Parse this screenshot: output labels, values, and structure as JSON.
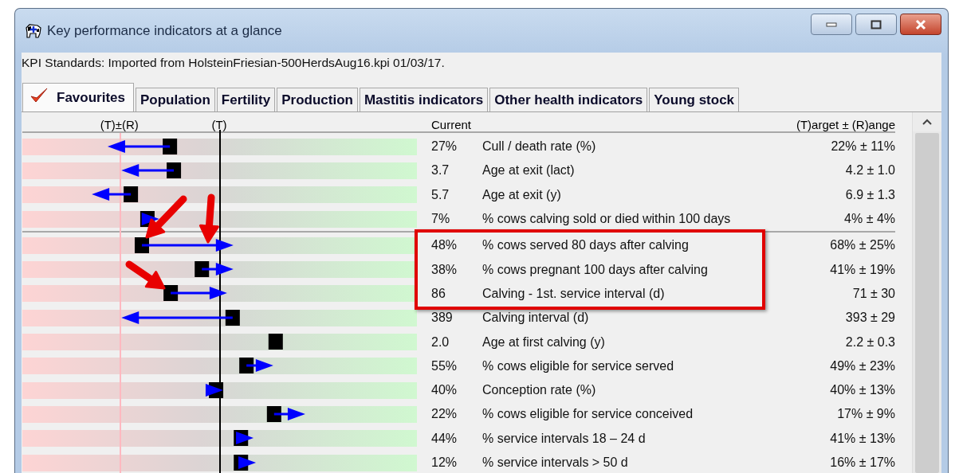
{
  "window": {
    "title": "Key performance indicators at a glance"
  },
  "standards": "KPI Standards: Imported from HolsteinFriesian-500HerdsAug16.kpi 01/03/17.",
  "tabs": [
    {
      "label": "Favourites",
      "selected": true
    },
    {
      "label": "Population",
      "selected": false
    },
    {
      "label": "Fertility",
      "selected": false
    },
    {
      "label": "Production",
      "selected": false
    },
    {
      "label": "Mastitis indicators",
      "selected": false
    },
    {
      "label": "Other health indicators",
      "selected": false
    },
    {
      "label": "Young stock",
      "selected": false
    }
  ],
  "header": {
    "range_label": "(T)±(R)",
    "target_label": "(T)",
    "current": "Current",
    "target_range": "(T)arget ± (R)ange"
  },
  "groups": [
    {
      "rows": [
        {
          "current_value": "27%",
          "name": "Cull / death rate (%)",
          "target": "22% ± 11%",
          "highlighted": false,
          "current": {
            "level": 0.374
          },
          "has_trend": true
        },
        {
          "current_value": "3.7",
          "name": "Age at exit (lact)",
          "target": "4.2 ± 1.0",
          "highlighted": false,
          "current": {
            "level": 0.384
          },
          "has_trend": true
        },
        {
          "current_value": "5.7",
          "name": "Age at exit (y)",
          "target": "6.9 ± 1.3",
          "highlighted": false,
          "current": {
            "level": 0.275
          },
          "has_trend": true
        },
        {
          "current_value": "7%",
          "name": "% cows calving sold or died within 100 days",
          "target": "4% ± 4%",
          "highlighted": false,
          "current": {
            "level": 0.317
          },
          "has_trend": true
        }
      ]
    },
    {
      "rows": [
        {
          "current_value": "48%",
          "name": "% cows served 80 days after calving",
          "target": "68% ± 25%",
          "highlighted": true,
          "current": {
            "level": 0.303
          },
          "has_trend": true,
          "pointers": [
            {
              "kind": "slash"
            },
            {
              "kind": "vertical"
            }
          ]
        },
        {
          "current_value": "38%",
          "name": "% cows pregnant 100 days after calving",
          "target": "41% ± 19%",
          "highlighted": true,
          "current": {
            "level": 0.455
          },
          "has_trend": true
        },
        {
          "current_value": "86",
          "name": "Calving - 1st. service interval (d)",
          "target": "71 ± 30",
          "highlighted": true,
          "current": {
            "level": 0.376
          },
          "has_trend": true,
          "pointers": [
            {
              "kind": "backslash"
            }
          ]
        },
        {
          "current_value": "389",
          "name": "Calving interval (d)",
          "target": "393 ± 29",
          "highlighted": false,
          "current": {
            "level": 0.533
          },
          "has_trend": true
        },
        {
          "current_value": "2.0",
          "name": "Age at first calving (y)",
          "target": "2.2 ± 0.3",
          "highlighted": false,
          "current": {
            "level": 0.642
          },
          "has_trend": false
        },
        {
          "current_value": "55%",
          "name": "% cows eligible for service served",
          "target": "49% ± 23%",
          "highlighted": false,
          "current": {
            "level": 0.568
          },
          "has_trend": true
        },
        {
          "current_value": "40%",
          "name": "Conception rate (%)",
          "target": "40% ± 13%",
          "highlighted": false,
          "current": {
            "level": 0.491
          },
          "has_trend": true
        },
        {
          "current_value": "22%",
          "name": "% cows eligible for service conceived",
          "target": "17% ± 9%",
          "highlighted": false,
          "current": {
            "level": 0.638
          },
          "has_trend": true
        },
        {
          "current_value": "44%",
          "name": "% service intervals 18 – 24 d",
          "target": "41% ± 13%",
          "highlighted": false,
          "current": {
            "level": 0.554
          },
          "has_trend": true
        },
        {
          "current_value": "12%",
          "name": "% service intervals > 50 d",
          "target": "16% ± 17%",
          "highlighted": false,
          "current": {
            "level": 0.554
          },
          "has_trend": true
        }
      ]
    }
  ]
}
